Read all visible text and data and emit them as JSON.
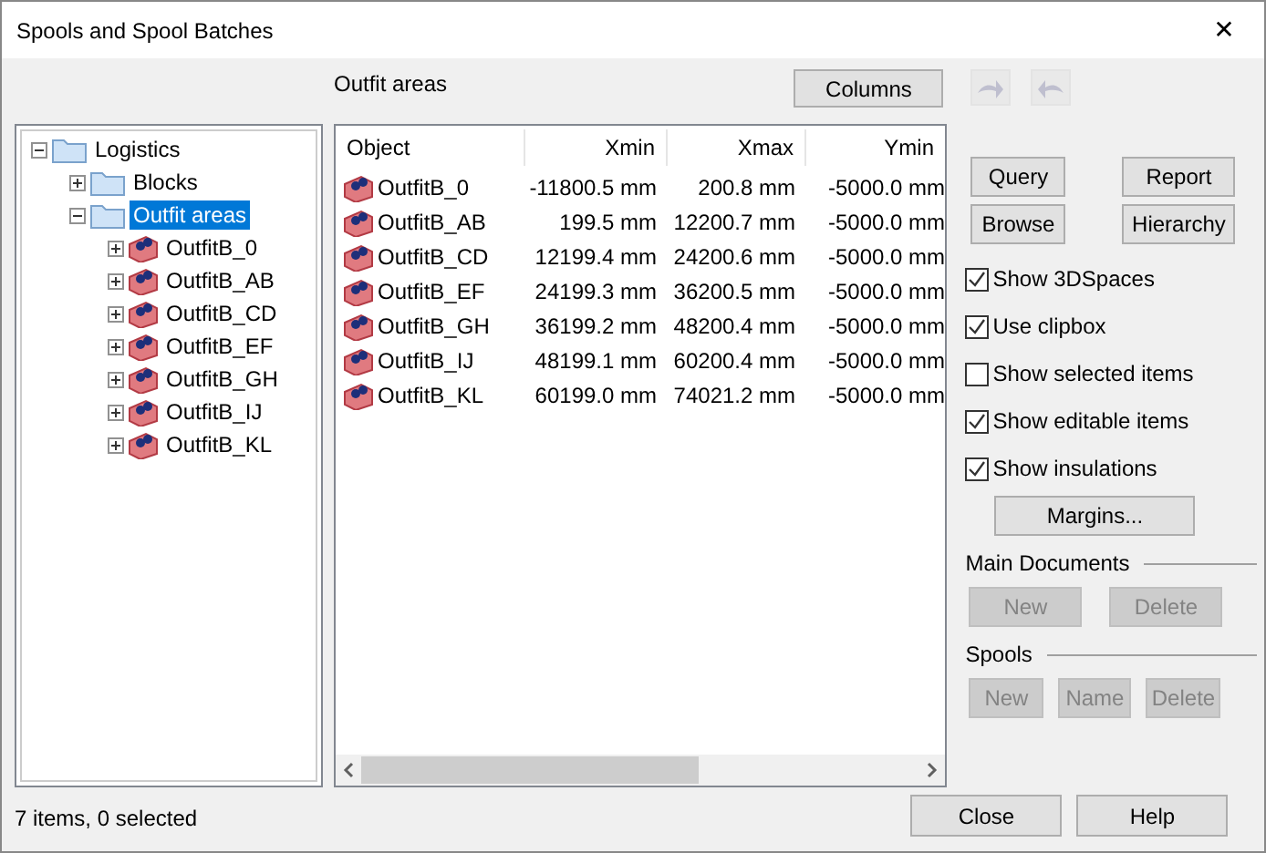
{
  "window": {
    "title": "Spools and Spool Batches",
    "close": "✕"
  },
  "tree": [
    {
      "label": "Logistics",
      "kind": "folder",
      "expanded": true,
      "selected": false,
      "children": [
        {
          "label": "Blocks",
          "kind": "folder",
          "expanded": false,
          "selected": false
        },
        {
          "label": "Outfit areas",
          "kind": "folder",
          "expanded": true,
          "selected": true,
          "children": [
            {
              "label": "OutfitB_0",
              "kind": "block",
              "expanded": false,
              "selected": false
            },
            {
              "label": "OutfitB_AB",
              "kind": "block",
              "expanded": false,
              "selected": false
            },
            {
              "label": "OutfitB_CD",
              "kind": "block",
              "expanded": false,
              "selected": false
            },
            {
              "label": "OutfitB_EF",
              "kind": "block",
              "expanded": false,
              "selected": false
            },
            {
              "label": "OutfitB_GH",
              "kind": "block",
              "expanded": false,
              "selected": false
            },
            {
              "label": "OutfitB_IJ",
              "kind": "block",
              "expanded": false,
              "selected": false
            },
            {
              "label": "OutfitB_KL",
              "kind": "block",
              "expanded": false,
              "selected": false
            }
          ]
        }
      ]
    }
  ],
  "list_title": "Outfit areas",
  "columns_button": "Columns",
  "table": {
    "columns": [
      "Object",
      "Xmin",
      "Xmax",
      "Ymin"
    ],
    "rows": [
      [
        "OutfitB_0",
        "-11800.5 mm",
        "200.8 mm",
        "-5000.0 mm"
      ],
      [
        "OutfitB_AB",
        "199.5 mm",
        "12200.7 mm",
        "-5000.0 mm"
      ],
      [
        "OutfitB_CD",
        "12199.4 mm",
        "24200.6 mm",
        "-5000.0 mm"
      ],
      [
        "OutfitB_EF",
        "24199.3 mm",
        "36200.5 mm",
        "-5000.0 mm"
      ],
      [
        "OutfitB_GH",
        "36199.2 mm",
        "48200.4 mm",
        "-5000.0 mm"
      ],
      [
        "OutfitB_IJ",
        "48199.1 mm",
        "60200.4 mm",
        "-5000.0 mm"
      ],
      [
        "OutfitB_KL",
        "60199.0 mm",
        "74021.2 mm",
        "-5000.0 mm"
      ]
    ]
  },
  "nav_buttons": [
    {
      "kind": "forward",
      "disabled": true
    },
    {
      "kind": "back",
      "disabled": true
    }
  ],
  "action_buttons": [
    {
      "label": "Query",
      "disabled": false
    },
    {
      "label": "Report",
      "disabled": false
    },
    {
      "label": "Browse",
      "disabled": false
    },
    {
      "label": "Hierarchy",
      "disabled": false
    }
  ],
  "options": [
    {
      "label": "Show 3DSpaces",
      "checked": true
    },
    {
      "label": "Use clipbox",
      "checked": true
    },
    {
      "label": "Show selected items",
      "checked": false
    },
    {
      "label": "Show editable items",
      "checked": true
    },
    {
      "label": "Show insulations",
      "checked": true
    }
  ],
  "margins_button": "Margins...",
  "main_documents": {
    "title": "Main Documents",
    "buttons": [
      {
        "label": "New",
        "disabled": true
      },
      {
        "label": "Delete",
        "disabled": true
      }
    ]
  },
  "spools": {
    "title": "Spools",
    "buttons": [
      {
        "label": "New",
        "disabled": true
      },
      {
        "label": "Name",
        "disabled": true
      },
      {
        "label": "Delete",
        "disabled": true
      }
    ]
  },
  "status": "7 items, 0 selected",
  "footer_buttons": [
    "Close",
    "Help"
  ]
}
